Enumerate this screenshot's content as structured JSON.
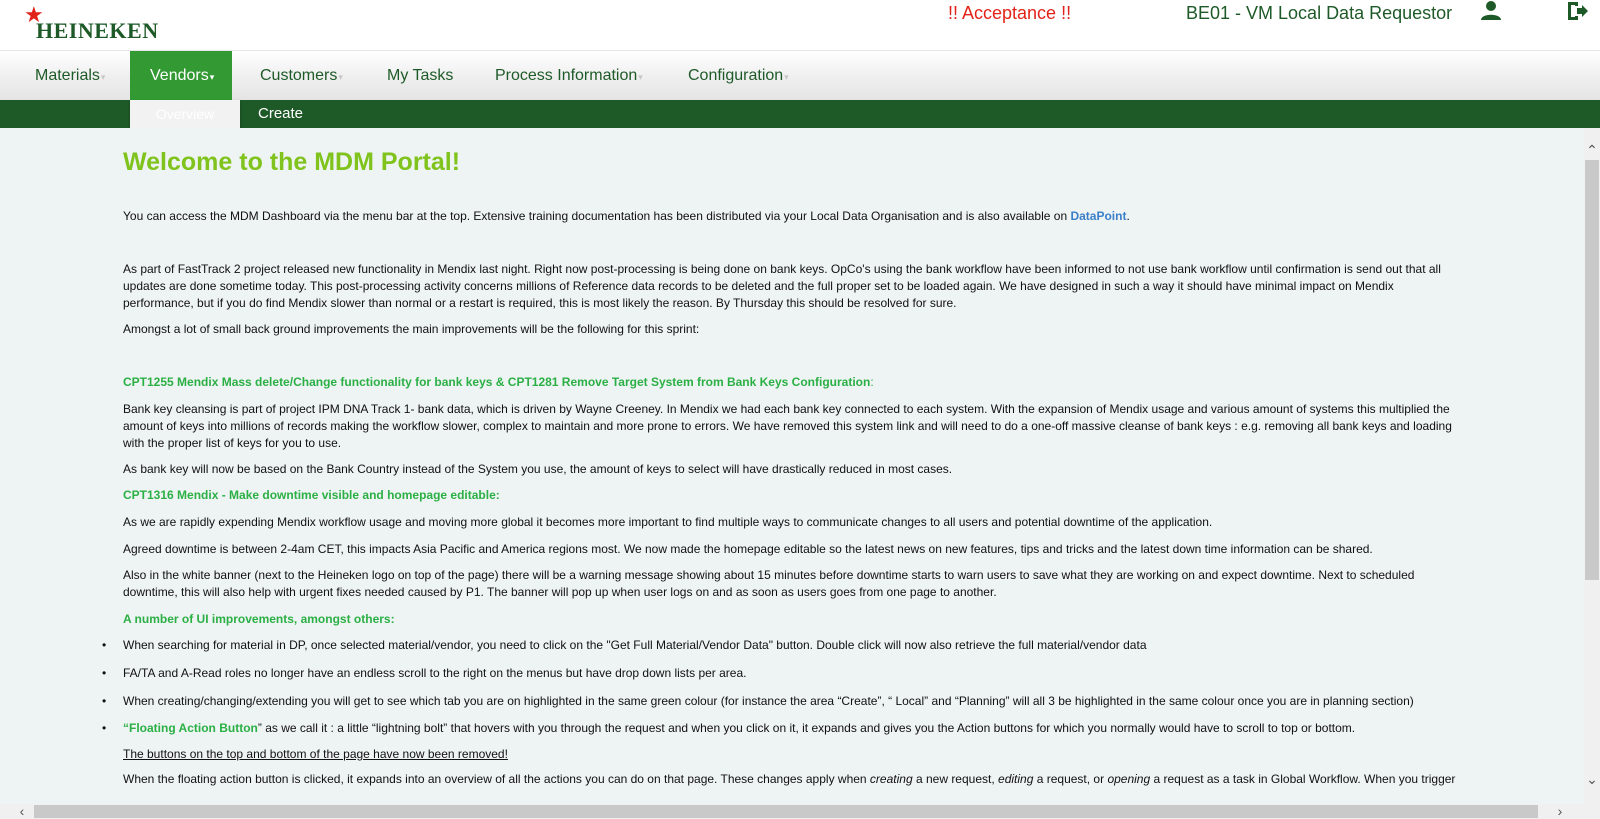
{
  "header": {
    "logo_text": "HEINEKEN",
    "logo_star": "★",
    "env_warning": "!! Acceptance !!",
    "user_role": "BE01 - VM Local Data Requestor",
    "user_icon": "user-icon",
    "logout_icon": "logout-icon"
  },
  "nav": {
    "items": [
      {
        "label": "Materials"
      },
      {
        "label": "Vendors"
      },
      {
        "label": "Customers"
      },
      {
        "label": "My Tasks"
      },
      {
        "label": "Process Information"
      },
      {
        "label": "Configuration"
      }
    ],
    "active": "Vendors"
  },
  "subnav": {
    "items": [
      {
        "label": "Overview"
      },
      {
        "label": "Create"
      }
    ]
  },
  "content": {
    "title": "Welcome to the MDM Portal!",
    "intro_text": "You can access the MDM Dashboard via the menu bar at the top. Extensive training documentation has been distributed via your Local Data Organisation and is also available on ",
    "intro_link": "DataPoint",
    "intro_end": ".",
    "p_fasttrack": "As part of FastTrack 2 project released new functionality in Mendix last night. Right now post-processing is being done on bank keys. OpCo's using the bank workflow have been informed to not use bank workflow until confirmation is send out that all updates are done sometime today. This post-processing activity concerns millions of Reference data records to be deleted and the full proper set to be loaded again. We have designed in such a way it should have minimal impact on Mendix performance, but if you do find Mendix slower than normal or a restart is required, this is most likely the reason. By Thursday this should be resolved for sure.",
    "p_amongst": "Amongst a lot of small back ground improvements the main improvements will be the following for this sprint:",
    "h_cpt1255": "CPT1255   Mendix Mass delete/Change functionality for bank keys & CPT1281 Remove Target System from Bank Keys Configuration",
    "h_cpt1255_colon": ":",
    "p_bankkey": "Bank key cleansing is part of project IPM DNA Track 1- bank data, which is driven by Wayne Creeney. In Mendix we had each bank key connected to each system. With the expansion of Mendix usage and various amount of systems this multiplied the amount of keys into millions of records making the workflow slower, complex to maintain and more prone to errors. We have removed this system link and will need to do a one-off massive cleanse of bank keys : e.g. removing all bank keys and loading with the proper list of keys for you to use.",
    "p_bankcountry": "As bank key will now be based on the Bank Country instead of the System you use, the amount of keys to select will have drastically reduced in most cases.",
    "h_cpt1316": "CPT1316  Mendix - Make downtime visible and homepage editable:",
    "p_expending": "As we are rapidly expending Mendix workflow usage and moving more global it becomes more important to find multiple ways to communicate changes to all users and potential downtime of the application.",
    "p_agreed": "Agreed downtime is between 2-4am CET, this impacts Asia Pacific and America regions most. We now made the homepage editable so the latest news on new features, tips and tricks and the latest down time information can be shared.",
    "p_banner": "Also in the white banner (next to the Heineken logo on top of the page) there will be a warning message showing about 15 minutes before downtime starts to warn users to save what they are working on and expect downtime. Next to scheduled downtime, this will also help with urgent fixes needed caused by P1. The banner will pop up when user logs on and as soon as users goes from one page to another.",
    "h_ui": "A number of UI improvements, amongst others:",
    "bullets": [
      "When searching for material in DP, once selected material/vendor, you need to click on the \"Get Full Material/Vendor Data\" button. Double click will now also retrieve the full material/vendor data",
      "FA/TA and A-Read roles no longer have an endless scroll to the right on the menus but have drop down lists per area.",
      "When creating/changing/extending you will get to see which tab you are on highlighted in the same green colour (for instance the area “Create”, “ Local” and  “Planning” will all 3 be highlighted in the same colour once you are in planning section)"
    ],
    "fab_head": "“Floating Action Button",
    "fab_text": "” as we call it :  a little “lightning bolt” that hovers with you through the request and when you click on it, it expands and gives you the Action buttons for which you normally would have to scroll to top or bottom.",
    "removed_text": "The buttons on the top and bottom of the page have now been removed!",
    "fab_detail_1": "When the floating action button is clicked, it expands into an overview of all the actions you can do on that page. These changes apply when ",
    "fab_detail_creating": "creating",
    "fab_detail_2": " a new request, ",
    "fab_detail_editing": "editing",
    "fab_detail_3": " a request, or ",
    "fab_detail_opening": "opening",
    "fab_detail_4": " a request as a task in Global Workflow. When you trigger"
  },
  "scrollbars": {
    "up_glyph": "⌃",
    "down_glyph": "⌄",
    "left_glyph": "‹",
    "right_glyph": "›"
  }
}
